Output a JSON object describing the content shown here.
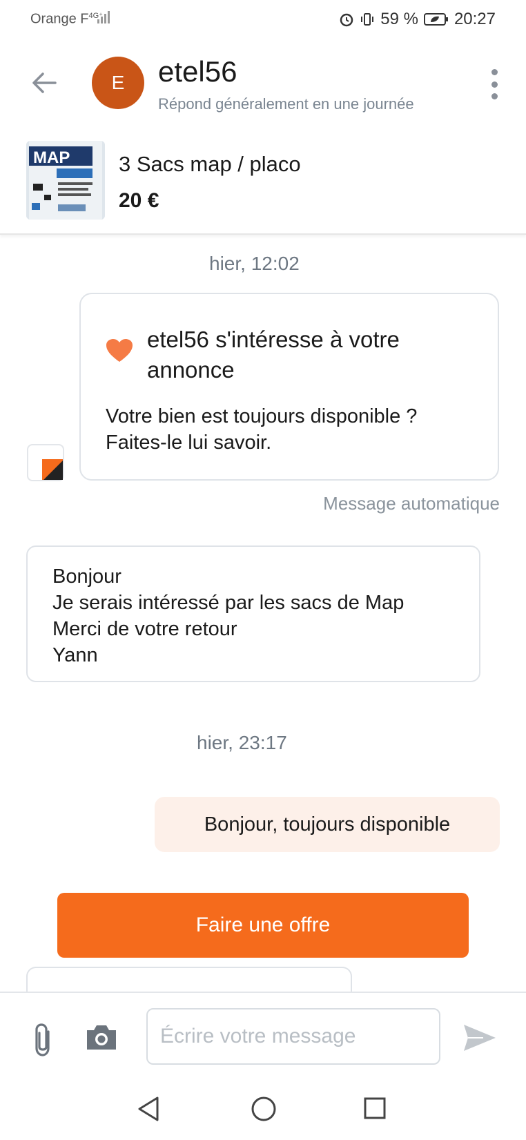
{
  "status_bar": {
    "carrier": "Orange F",
    "network": "4G⁺",
    "battery": "59 %",
    "time": "20:27"
  },
  "header": {
    "back_icon": "arrow-left-icon",
    "avatar_initial": "E",
    "user_name": "etel56",
    "response_time": "Répond généralement en une journée",
    "more_icon": "more-vertical-icon"
  },
  "listing": {
    "thumb_text": "MAP",
    "title": "3 Sacs map / placo",
    "price": "20 €"
  },
  "chat": {
    "date_1": "hier, 12:02",
    "auto_card": {
      "icon": "heart-icon",
      "title": "etel56 s'intéresse à votre annonce",
      "body": "Votre bien est toujours disponible ? Faites-le lui savoir.",
      "label": "Message automatique"
    },
    "incoming_message": {
      "lines": [
        "Bonjour",
        "Je serais intéressé par les sacs de Map",
        "Merci de votre retour",
        "Yann"
      ]
    },
    "date_2": "hier, 23:17",
    "outgoing_message": "Bonjour, toujours disponible",
    "offer_button": "Faire une offre"
  },
  "composer": {
    "placeholder": "Écrire votre message",
    "value": ""
  },
  "colors": {
    "accent": "#f56b1c",
    "avatar": "#c95517",
    "outgoing_bubble": "#fdf0e9"
  }
}
